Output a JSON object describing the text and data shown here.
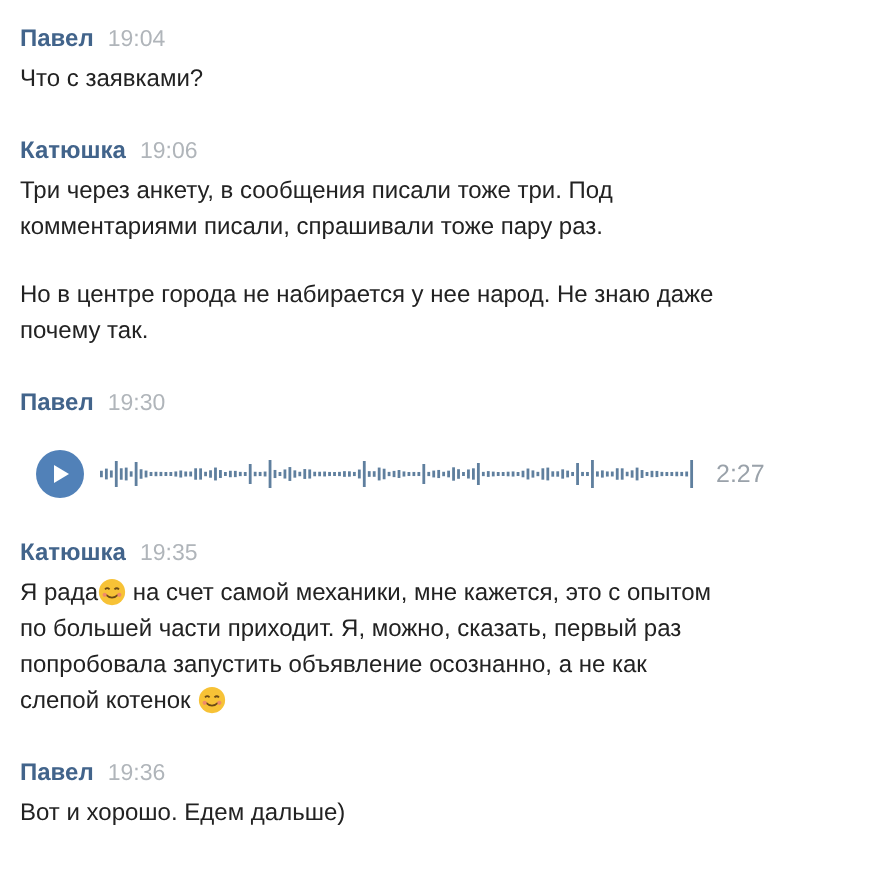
{
  "messages": [
    {
      "author": "Павел",
      "time": "19:04",
      "kind": "text",
      "paragraphs": [
        [
          [
            {
              "kind": "text",
              "text": "Что с заявками?"
            }
          ]
        ]
      ]
    },
    {
      "author": "Катюшка",
      "time": "19:06",
      "kind": "text",
      "paragraphs": [
        [
          [
            {
              "kind": "text",
              "text": "Три через анкету, в сообщения писали тоже три. Под"
            }
          ],
          [
            {
              "kind": "text",
              "text": "комментариями писали, спрашивали тоже пару раз."
            }
          ]
        ],
        [
          [
            {
              "kind": "text",
              "text": "Но в центре города не набирается у нее народ. Не знаю даже"
            }
          ],
          [
            {
              "kind": "text",
              "text": "почему так."
            }
          ]
        ]
      ]
    },
    {
      "author": "Павел",
      "time": "19:30",
      "kind": "voice",
      "duration": "2:27"
    },
    {
      "author": "Катюшка",
      "time": "19:35",
      "kind": "text",
      "paragraphs": [
        [
          [
            {
              "kind": "text",
              "text": "Я рада"
            },
            {
              "kind": "emoji"
            },
            {
              "kind": "text",
              "text": " на счет самой механики, мне кажется, это с опытом"
            }
          ],
          [
            {
              "kind": "text",
              "text": "по большей части приходит. Я, можно, сказать, первый раз"
            }
          ],
          [
            {
              "kind": "text",
              "text": "попробовала запустить объявление осознанно, а не как"
            }
          ],
          [
            {
              "kind": "text",
              "text": "слепой котенок "
            },
            {
              "kind": "emoji"
            }
          ]
        ]
      ]
    },
    {
      "author": "Павел",
      "time": "19:36",
      "kind": "text",
      "paragraphs": [
        [
          [
            {
              "kind": "text",
              "text": "Вот и хорошо. Едем дальше)"
            }
          ]
        ]
      ]
    }
  ]
}
